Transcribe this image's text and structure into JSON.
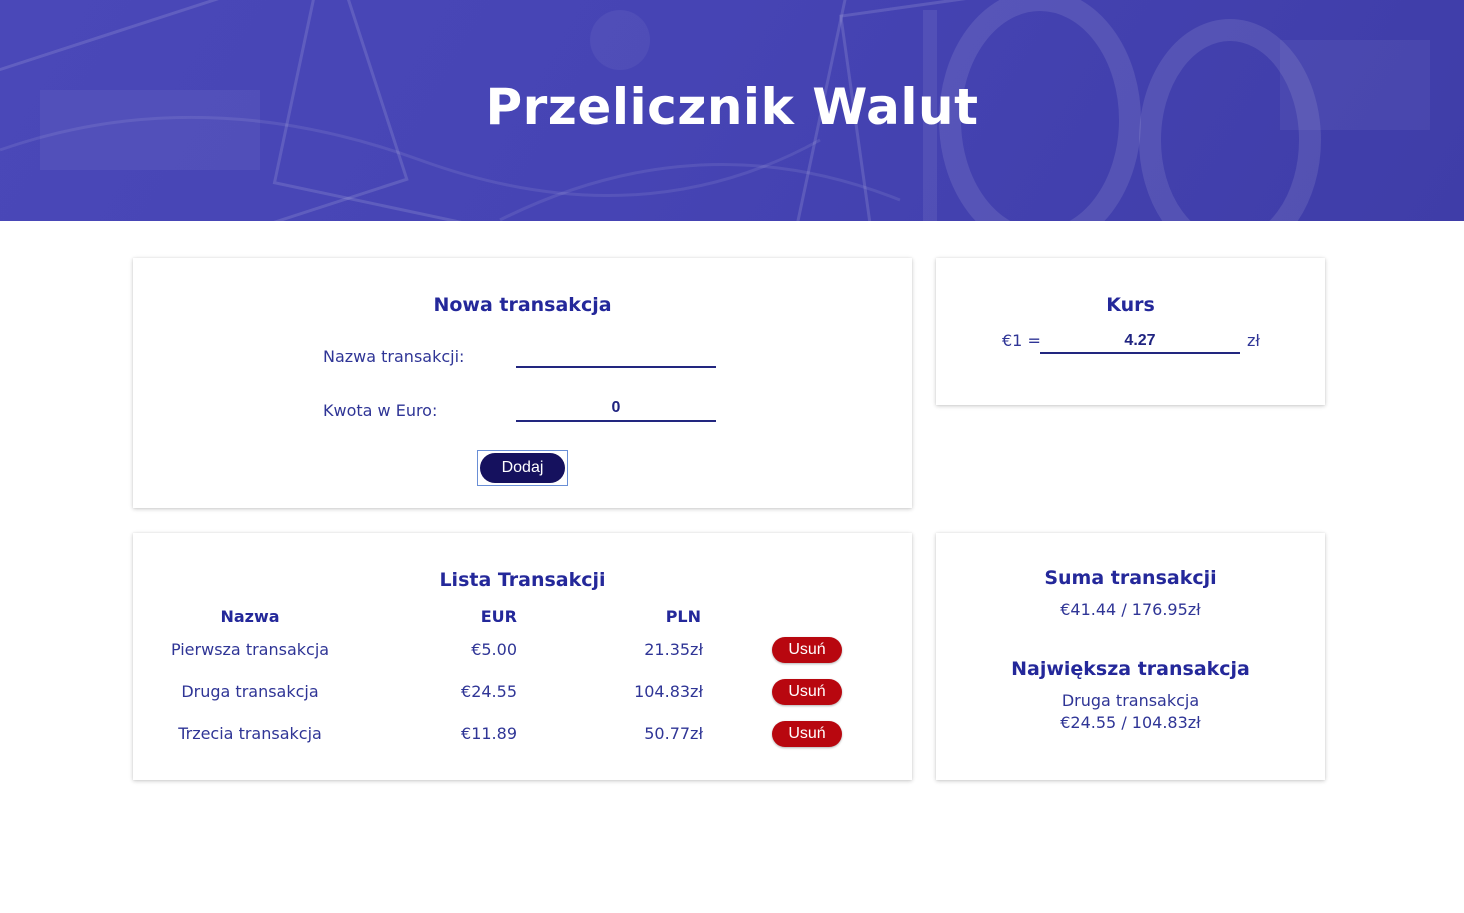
{
  "header": {
    "title": "Przelicznik Walut"
  },
  "new_transaction": {
    "title": "Nowa transakcja",
    "name_label": "Nazwa transakcji:",
    "name_value": "",
    "amount_label": "Kwota w Euro:",
    "amount_value": "0",
    "add_button": "Dodaj"
  },
  "rate": {
    "title": "Kurs",
    "prefix": "€1 =",
    "value": "4.27",
    "suffix": "zł"
  },
  "transactions": {
    "title": "Lista Transakcji",
    "columns": [
      "Nazwa",
      "EUR",
      "PLN"
    ],
    "rows": [
      {
        "name": "Pierwsza transakcja",
        "eur": "€5.00",
        "pln": "21.35zł",
        "delete": "Usuń"
      },
      {
        "name": "Druga transakcja",
        "eur": "€24.55",
        "pln": "104.83zł",
        "delete": "Usuń"
      },
      {
        "name": "Trzecia transakcja",
        "eur": "€11.89",
        "pln": "50.77zł",
        "delete": "Usuń"
      }
    ]
  },
  "summary": {
    "sum_title": "Suma transakcji",
    "sum_value": "€41.44 / 176.95zł",
    "largest_title": "Największa transakcja",
    "largest_name": "Druga transakcja",
    "largest_value": "€24.55 / 104.83zł"
  },
  "colors": {
    "hero": "#4a48b8",
    "accent": "#24289a",
    "button_primary": "#15115e",
    "button_danger": "#b8070f"
  }
}
